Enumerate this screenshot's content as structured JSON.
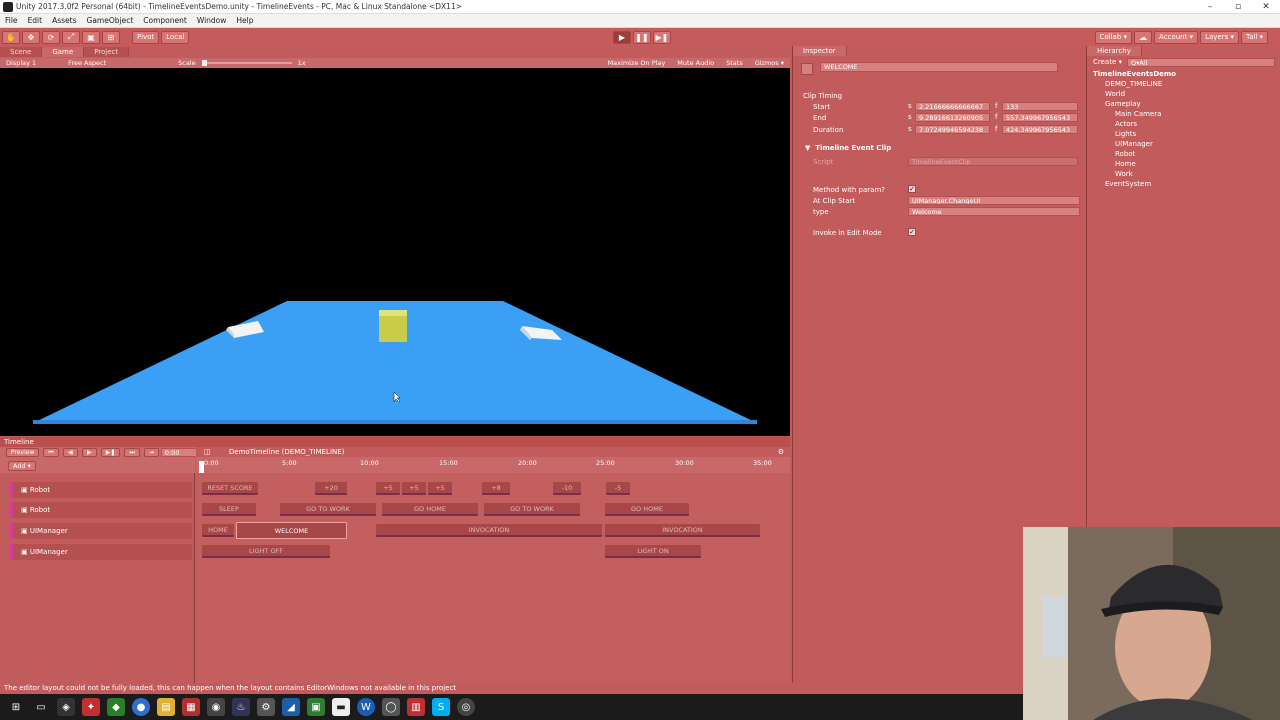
{
  "window": {
    "title": "Unity 2017.3.0f2 Personal (64bit) - TimelineEventsDemo.unity - TimelineEvents - PC, Mac & Linux Standalone <DX11>"
  },
  "menu": [
    "File",
    "Edit",
    "Assets",
    "GameObject",
    "Component",
    "Window",
    "Help"
  ],
  "toolbar": {
    "pivot": "Pivot",
    "local": "Local",
    "collab": "Collab ▾",
    "account": "Account ▾",
    "layers": "Layers ▾",
    "layout": "Tall ▾"
  },
  "tabs": {
    "scene": "Scene",
    "game": "Game",
    "project": "Project"
  },
  "gamebar": {
    "display": "Display 1",
    "aspect": "Free Aspect",
    "scale_label": "Scale",
    "scale_value": "1x",
    "maximize": "Maximize On Play",
    "mute": "Mute Audio",
    "stats": "Stats",
    "gizmos": "Gizmos ▾"
  },
  "timeline": {
    "title": "Timeline",
    "preview": "Preview",
    "time": "0:00",
    "add": "Add ▾",
    "asset": "DemoTimeline (DEMO_TIMELINE)",
    "ruler": [
      "0:00",
      "5:00",
      "10:00",
      "15:00",
      "20:00",
      "25:00",
      "30:00",
      "35:00"
    ],
    "tracks": [
      "Robot",
      "Robot",
      "UIManager",
      "UIManager"
    ],
    "clips": {
      "row1": [
        "RESET SCORE",
        "+20",
        "+5",
        "+5",
        "+5",
        "+8",
        "-10",
        "-5"
      ],
      "row2": [
        "SLEEP",
        "GO TO WORK",
        "GO HOME",
        "GO TO WORK",
        "GO HOME"
      ],
      "row3": [
        "HOME",
        "WELCOME",
        "INVOCATION",
        "INVOCATION"
      ],
      "row4": [
        "LIGHT OFF",
        "LIGHT ON"
      ]
    }
  },
  "inspector": {
    "tab": "Inspector",
    "name": "WELCOME",
    "clip_timing": "Clip Timing",
    "start_label": "Start",
    "start_s": "2.21666666666667",
    "start_f": "133",
    "end_label": "End",
    "end_s": "9.28916613260905",
    "end_f": "557.349967956543",
    "duration_label": "Duration",
    "duration_s": "7.07249946594238",
    "duration_f": "424.349967956543",
    "s": "s",
    "f": "f",
    "component": "Timeline Event Clip",
    "script_label": "Script",
    "script_value": "TimelineEventClip",
    "method_label": "Method with param?",
    "atstart_label": "At Clip Start",
    "atstart_value": "UIManager.ChangeUI",
    "type_label": "type",
    "type_value": "Welcome",
    "invoke_label": "Invoke in Edit Mode"
  },
  "hierarchy": {
    "tab": "Hierarchy",
    "create": "Create ▾",
    "search": "Q▾All",
    "scene": "TimelineEventsDemo",
    "items": [
      "DEMO_TIMELINE",
      "World",
      "Gameplay",
      "Main Camera",
      "Actors",
      "Lights",
      "UIManager",
      "Robot",
      "Home",
      "Work",
      "EventSystem"
    ]
  },
  "status": "The editor layout could not be fully loaded, this can happen when the layout contains EditorWindows not available in this project",
  "colors": {
    "play_tint": "#c25c5c",
    "field": "#d88080",
    "track_accent": "#d53b9a",
    "gameview_floor": "#3ba0f5"
  }
}
